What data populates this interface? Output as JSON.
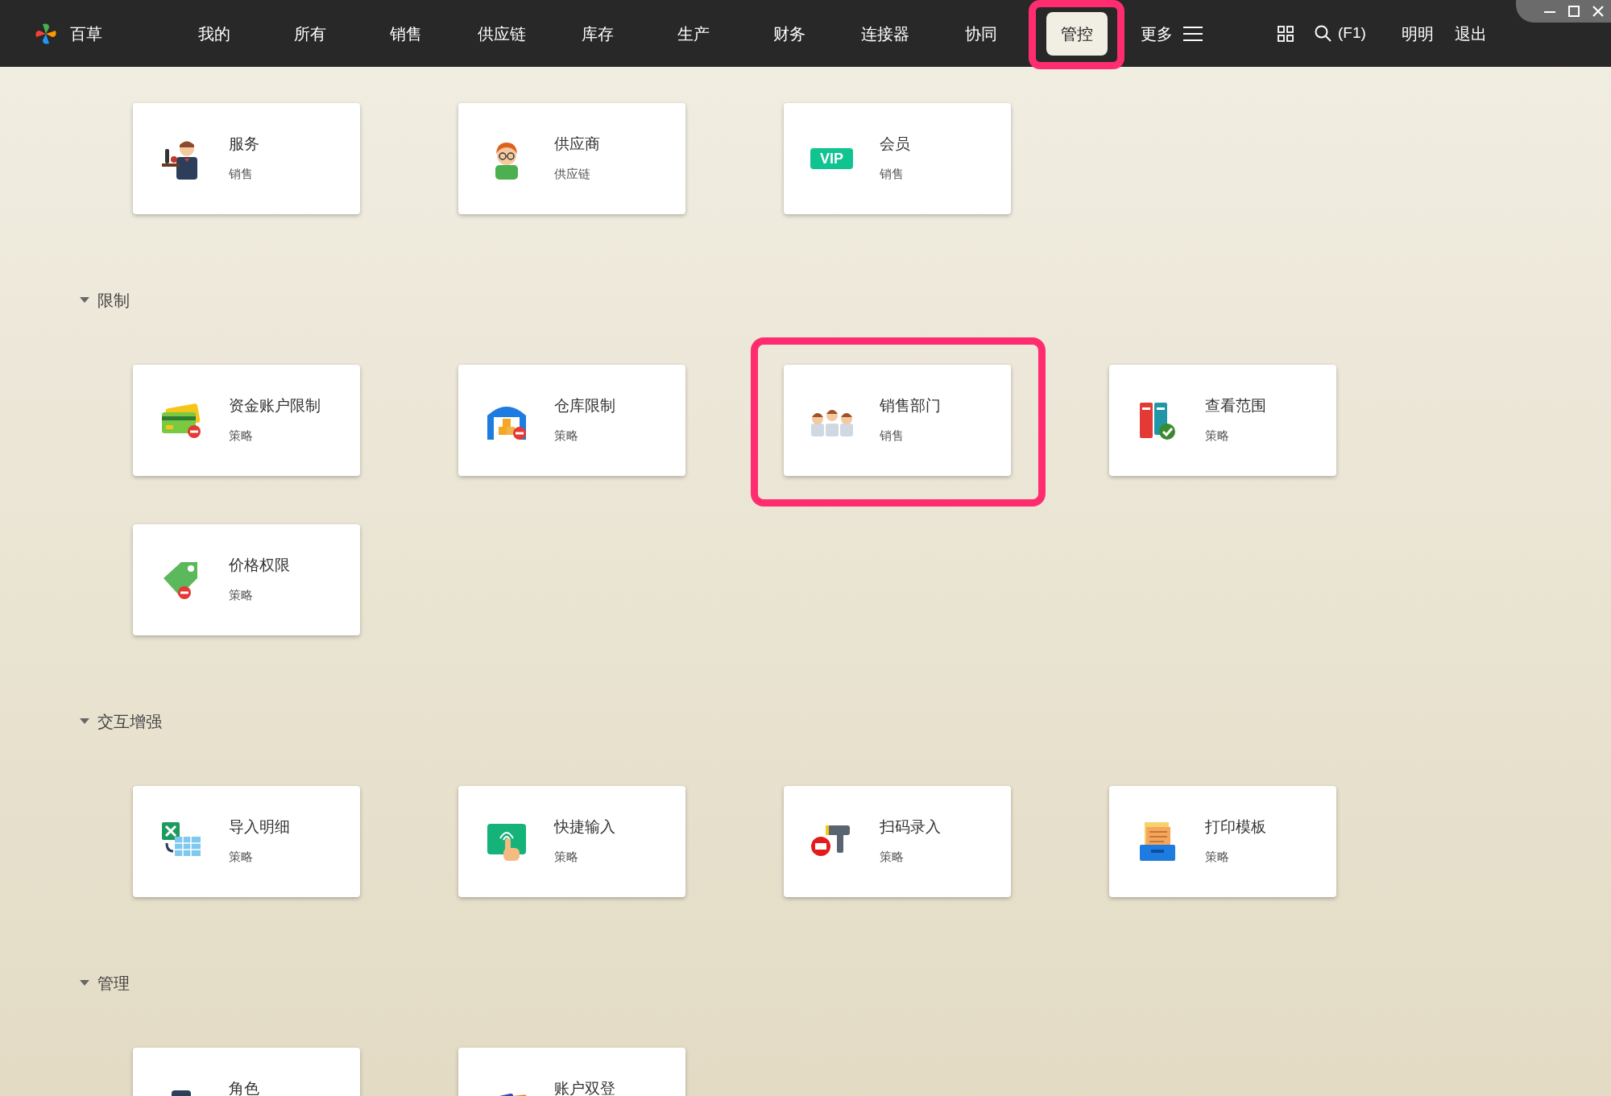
{
  "app": {
    "name": "百草"
  },
  "nav": [
    {
      "label": "我的",
      "selected": false
    },
    {
      "label": "所有",
      "selected": false
    },
    {
      "label": "销售",
      "selected": false
    },
    {
      "label": "供应链",
      "selected": false
    },
    {
      "label": "库存",
      "selected": false
    },
    {
      "label": "生产",
      "selected": false
    },
    {
      "label": "财务",
      "selected": false
    },
    {
      "label": "连接器",
      "selected": false
    },
    {
      "label": "协同",
      "selected": false
    },
    {
      "label": "管控",
      "selected": true,
      "highlighted": true
    }
  ],
  "more": {
    "label": "更多"
  },
  "search": {
    "shortcut": "(F1)"
  },
  "user": {
    "name": "明明"
  },
  "logout": {
    "label": "退出"
  },
  "sections": [
    {
      "cards": [
        {
          "title": "服务",
          "subtitle": "销售",
          "highlighted": false
        },
        {
          "title": "供应商",
          "subtitle": "供应链",
          "highlighted": false
        },
        {
          "title": "会员",
          "subtitle": "销售",
          "highlighted": false,
          "badge": "VIP"
        }
      ]
    },
    {
      "title": "限制",
      "expanded": true,
      "cards": [
        {
          "title": "资金账户限制",
          "subtitle": "策略",
          "highlighted": false
        },
        {
          "title": "仓库限制",
          "subtitle": "策略",
          "highlighted": false
        },
        {
          "title": "销售部门",
          "subtitle": "销售",
          "highlighted": true
        },
        {
          "title": "查看范围",
          "subtitle": "策略",
          "highlighted": false
        },
        {
          "title": "价格权限",
          "subtitle": "策略",
          "highlighted": false
        }
      ]
    },
    {
      "title": "交互增强",
      "expanded": true,
      "cards": [
        {
          "title": "导入明细",
          "subtitle": "策略",
          "highlighted": false
        },
        {
          "title": "快捷输入",
          "subtitle": "策略",
          "highlighted": false
        },
        {
          "title": "扫码录入",
          "subtitle": "策略",
          "highlighted": false
        },
        {
          "title": "打印模板",
          "subtitle": "策略",
          "highlighted": false
        }
      ]
    },
    {
      "title": "管理",
      "expanded": true,
      "cards": [
        {
          "title": "角色",
          "highlighted": false
        },
        {
          "title": "账户双登",
          "highlighted": false
        }
      ]
    }
  ]
}
